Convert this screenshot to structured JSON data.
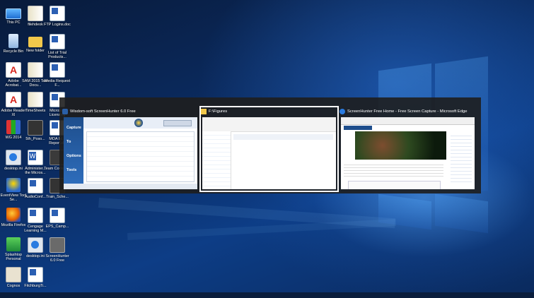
{
  "desktop_icons": [
    {
      "label": "This PC",
      "icon": "pc-icon"
    },
    {
      "label": "filehdeok",
      "icon": "book-icon"
    },
    {
      "label": "FTP Logins.doc",
      "icon": "doc-icon"
    },
    {
      "label": "Recycle Bin",
      "icon": "recycle-bin-icon"
    },
    {
      "label": "New folder",
      "icon": "folder-icon"
    },
    {
      "label": "List of Trial Products...",
      "icon": "doc-icon"
    },
    {
      "label": "Adobe Acrobat...",
      "icon": "pdf-icon"
    },
    {
      "label": "SAM 2015 Task Docu...",
      "icon": "book-icon"
    },
    {
      "label": "Media Request F...",
      "icon": "doc-icon"
    },
    {
      "label": "Adobe Reader XI",
      "icon": "pdf-icon"
    },
    {
      "label": "TimeSheets",
      "icon": "book-icon"
    },
    {
      "label": "Microsoft Licensing",
      "icon": "doc-icon"
    },
    {
      "label": "WG 2014",
      "icon": "grid-icon"
    },
    {
      "label": "5th_Poso...",
      "icon": "film-icon"
    },
    {
      "label": "MOA Isl... Report.do",
      "icon": "doc-icon"
    },
    {
      "label": "desktop.ini",
      "icon": "gear-icon"
    },
    {
      "label": "Administer... the Micros...",
      "icon": "word-icon"
    },
    {
      "label": "Team Contact n",
      "icon": "dark-icon"
    },
    {
      "label": "EventView Tool Se...",
      "icon": "bulb-icon"
    },
    {
      "label": "AudioConf...",
      "icon": "doc-icon"
    },
    {
      "label": "Train_Sche...",
      "icon": "film-icon"
    },
    {
      "label": "Mozilla Firefox",
      "icon": "firefox-icon"
    },
    {
      "label": "Cengage Learning M...",
      "icon": "doc-icon"
    },
    {
      "label": "EPS_Camp...",
      "icon": "doc-icon"
    },
    {
      "label": "Splashtop Personal",
      "icon": "splashtop-icon"
    },
    {
      "label": "desktop.ini",
      "icon": "gear-icon"
    },
    {
      "label": "ScreenHunter 6.0 Free",
      "icon": "hand-icon"
    },
    {
      "label": "Cognos",
      "icon": "cog-icon"
    },
    {
      "label": "FitchburgTi...",
      "icon": "doc-icon"
    }
  ],
  "switcher": {
    "windows": [
      {
        "title": "Wisdom-soft ScreenHunter 6.0 Free",
        "app": "screenhunter",
        "selected": false,
        "nav": [
          "Capture",
          "To",
          "Options",
          "Tools"
        ]
      },
      {
        "title": "F:\\Figures",
        "app": "explorer",
        "selected": true
      },
      {
        "title": "ScreenHunter Free Home - Free Screen Capture - Microsoft Edge",
        "app": "edge",
        "selected": false
      }
    ]
  },
  "colors": {
    "desktop_bg": "#0b2c62",
    "switcher_bg": "#1e1e1e",
    "accent": "#2a7be0"
  }
}
